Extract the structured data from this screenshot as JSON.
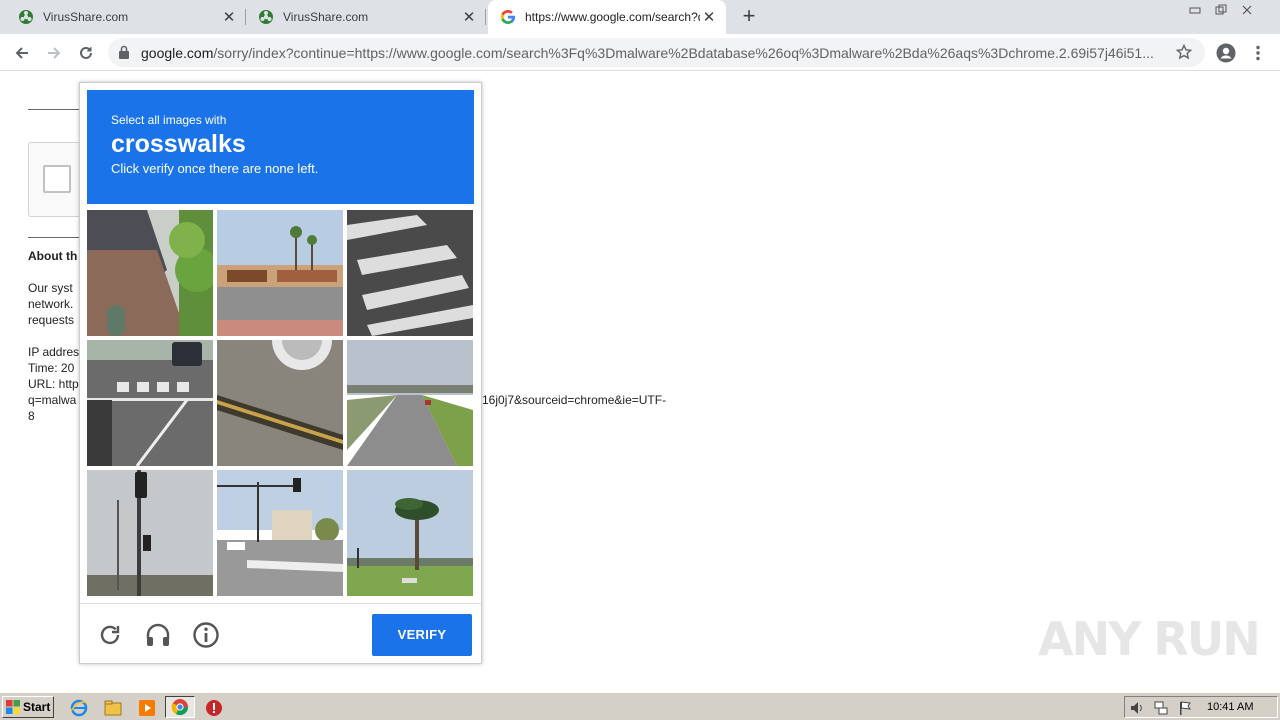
{
  "browser": {
    "tabs": [
      {
        "title": "VirusShare.com",
        "active": false
      },
      {
        "title": "VirusShare.com",
        "active": false
      },
      {
        "title": "https://www.google.com/search?q=",
        "active": true
      }
    ],
    "url_host": "google.com",
    "url_rest": "/sorry/index?continue=https://www.google.com/search%3Fq%3Dmalware%2Bdatabase%26oq%3Dmalware%2Bda%26aqs%3Dchrome.2.69i57j46i51..."
  },
  "page": {
    "about_heading": "About th",
    "para": [
      "Our syst",
      "network.",
      "requests"
    ],
    "ip_line": "IP addres",
    "time_line": "Time: 20",
    "url_line": "URL: http",
    "q_line": "q=malwa",
    "url_tail": "16j0j7&sourceid=chrome&ie=UTF-",
    "url_tail2": "8"
  },
  "captcha": {
    "instruction": "Select all images with",
    "target": "crosswalks",
    "hint": "Click verify once there are none left.",
    "verify_label": "VERIFY",
    "tiles": [
      {
        "name": "tile-1",
        "scene": "brick-house"
      },
      {
        "name": "tile-2",
        "scene": "strip-mall"
      },
      {
        "name": "tile-3",
        "scene": "crosswalk-closeup"
      },
      {
        "name": "tile-4",
        "scene": "intersection-crosswalk"
      },
      {
        "name": "tile-5",
        "scene": "curb-tire"
      },
      {
        "name": "tile-6",
        "scene": "highway"
      },
      {
        "name": "tile-7",
        "scene": "traffic-light-pole"
      },
      {
        "name": "tile-8",
        "scene": "intersection-signal"
      },
      {
        "name": "tile-9",
        "scene": "palm-trees"
      }
    ]
  },
  "watermark": "ANY RUN",
  "taskbar": {
    "start_label": "Start",
    "clock": "10:41 AM"
  },
  "colors": {
    "accent": "#1a73e8",
    "tabstrip": "#dee1e6",
    "taskbar": "#d4d0c8"
  }
}
